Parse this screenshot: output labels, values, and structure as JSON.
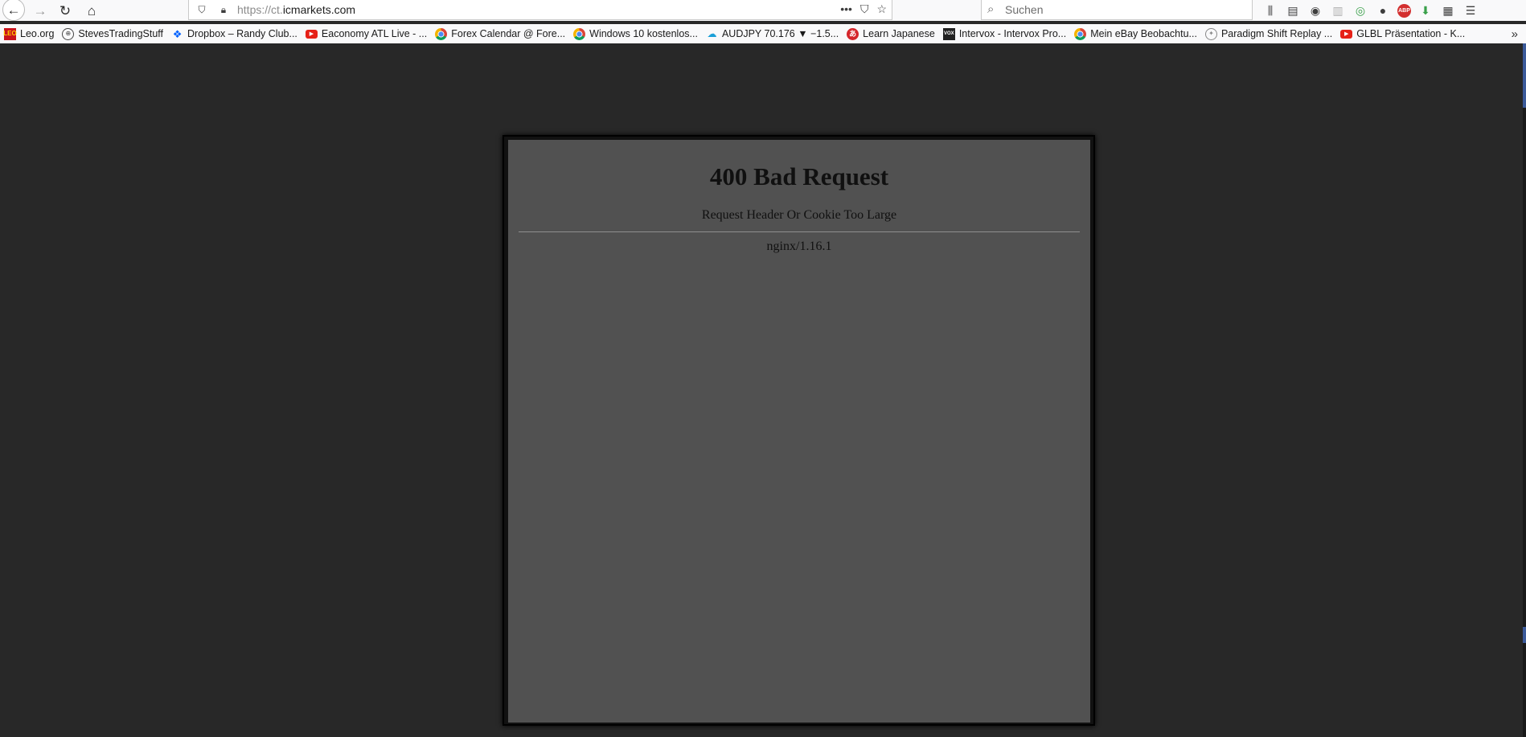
{
  "browser": {
    "url_scheme_prefix": "https://ct.",
    "url_host": "icmarkets.com",
    "url_actions": [
      "•••",
      "⛉",
      "☆"
    ],
    "search_placeholder": "Suchen"
  },
  "bookmarks": [
    {
      "label": "Leo.org",
      "icon": "leo-icon",
      "glyph": "LEO"
    },
    {
      "label": "StevesTradingStuff",
      "icon": "globe-icon",
      "glyph": "⊕"
    },
    {
      "label": "Dropbox – Randy Club...",
      "icon": "dropbox-icon",
      "glyph": "❖"
    },
    {
      "label": "Eaconomy ATL Live - ...",
      "icon": "youtube-icon",
      "glyph": "▶"
    },
    {
      "label": "Forex Calendar @ Fore...",
      "icon": "chrome-icon",
      "glyph": ""
    },
    {
      "label": "Windows 10 kostenlos...",
      "icon": "chrome-icon",
      "glyph": ""
    },
    {
      "label": "AUDJPY 70.176 ▼ −1.5...",
      "icon": "cloud-icon",
      "glyph": "☁"
    },
    {
      "label": "Learn Japanese",
      "icon": "learn-japanese-icon",
      "glyph": "あ"
    },
    {
      "label": "Intervox - Intervox Pro...",
      "icon": "intervox-icon",
      "glyph": "VOX"
    },
    {
      "label": "Mein eBay Beobachtu...",
      "icon": "chrome-icon",
      "glyph": ""
    },
    {
      "label": "Paradigm Shift Replay ...",
      "icon": "mercedes-icon",
      "glyph": "✦"
    },
    {
      "label": "GLBL Präsentation - K...",
      "icon": "youtube-icon",
      "glyph": "▶"
    }
  ],
  "bookmarks_overflow": "»",
  "error": {
    "title": "400 Bad Request",
    "message": "Request Header Or Cookie Too Large",
    "server": "nginx/1.16.1"
  },
  "colors": {
    "page_background": "#282828",
    "document_background": "#515151",
    "chrome_background": "#f9f9fa"
  }
}
